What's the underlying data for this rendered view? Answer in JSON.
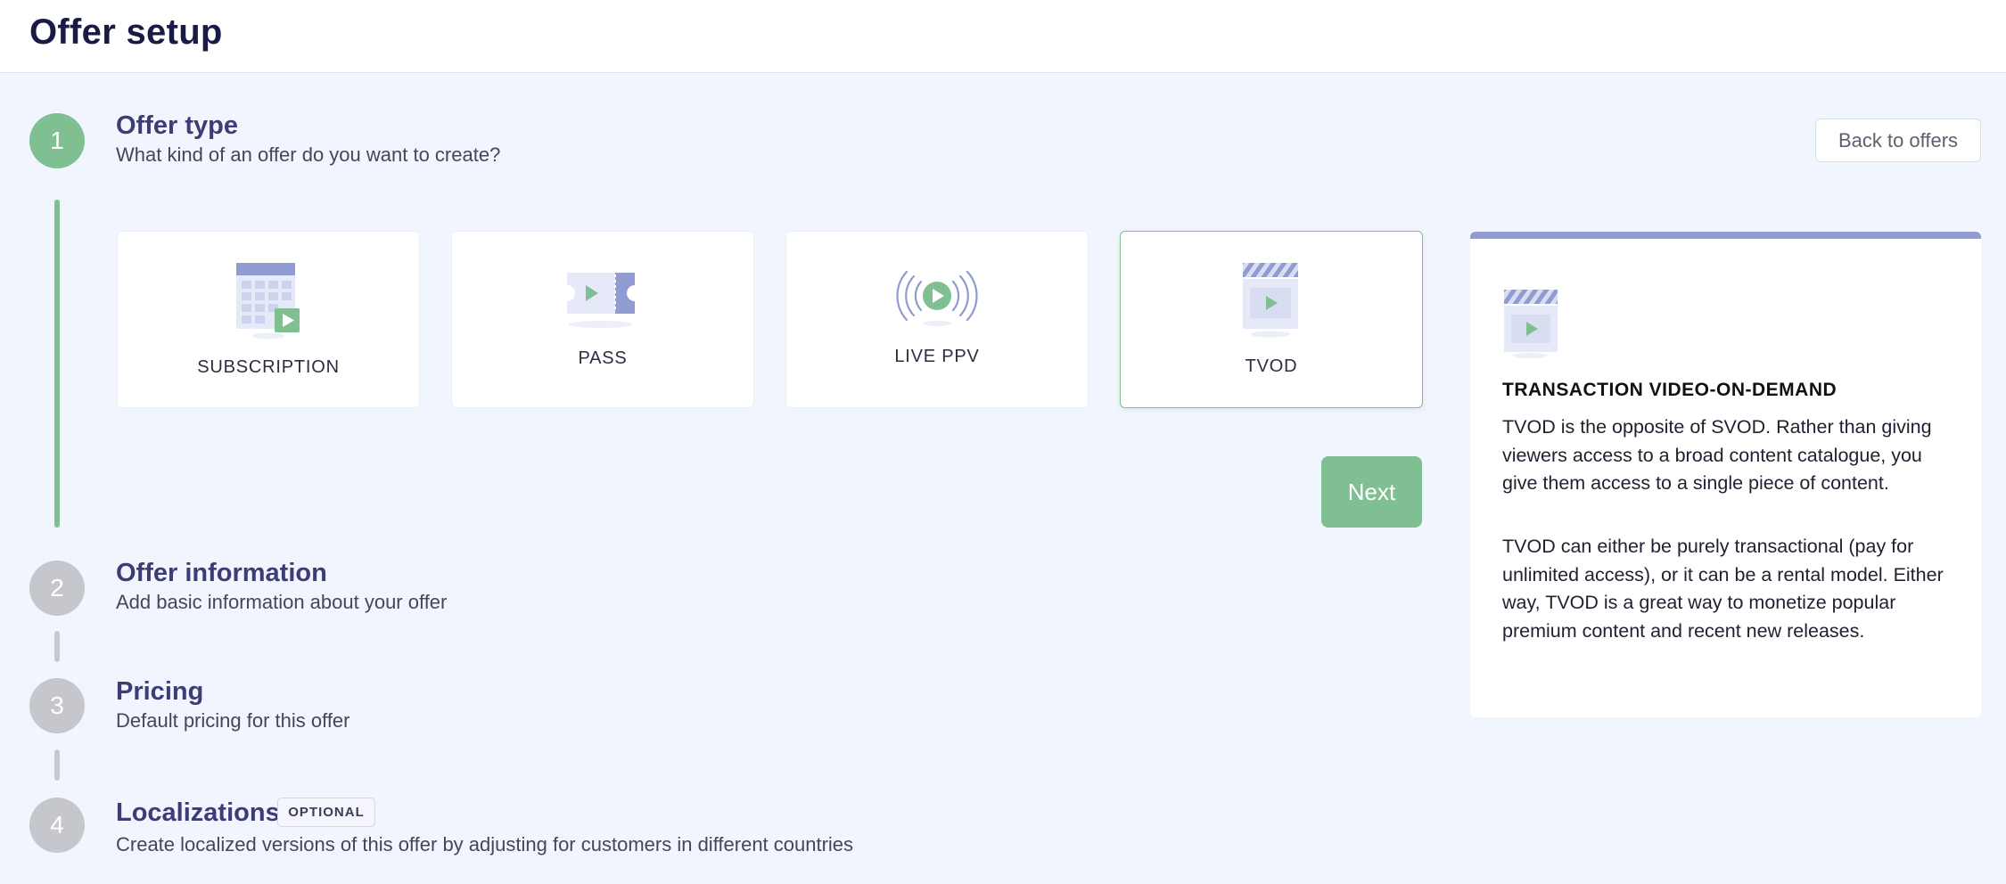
{
  "header": {
    "title": "Offer setup"
  },
  "steps": [
    {
      "number": "1",
      "title": "Offer type",
      "subtitle": "What kind of an offer do you want to create?"
    },
    {
      "number": "2",
      "title": "Offer information",
      "subtitle": "Add basic information about your offer"
    },
    {
      "number": "3",
      "title": "Pricing",
      "subtitle": "Default pricing for this offer"
    },
    {
      "number": "4",
      "title": "Localizations",
      "subtitle": "Create localized versions of this offer by adjusting for customers in different countries",
      "badge": "OPTIONAL"
    }
  ],
  "back_button": {
    "label": "Back to offers"
  },
  "offer_types": [
    {
      "label": "SUBSCRIPTION",
      "icon": "calendar-play-icon"
    },
    {
      "label": "PASS",
      "icon": "ticket-icon"
    },
    {
      "label": "LIVE PPV",
      "icon": "broadcast-play-icon"
    },
    {
      "label": "TVOD",
      "icon": "clapperboard-icon",
      "selected": true
    }
  ],
  "next_button": {
    "label": "Next"
  },
  "info_panel": {
    "icon": "clapperboard-icon",
    "title": "TRANSACTION VIDEO-ON-DEMAND",
    "paragraph1": "TVOD is the opposite of SVOD. Rather than giving viewers access to a broad content catalogue, you give them access to a single piece of content.",
    "paragraph2": "TVOD can either be purely transactional (pay for unlimited access), or it can be a rental model. Either way, TVOD is a great way to monetize popular premium content and recent new releases."
  },
  "colors": {
    "accent_green": "#7fbf92",
    "accent_purple": "#8f9bd1",
    "background": "#f1f5fd",
    "heading": "#1a1b44"
  }
}
